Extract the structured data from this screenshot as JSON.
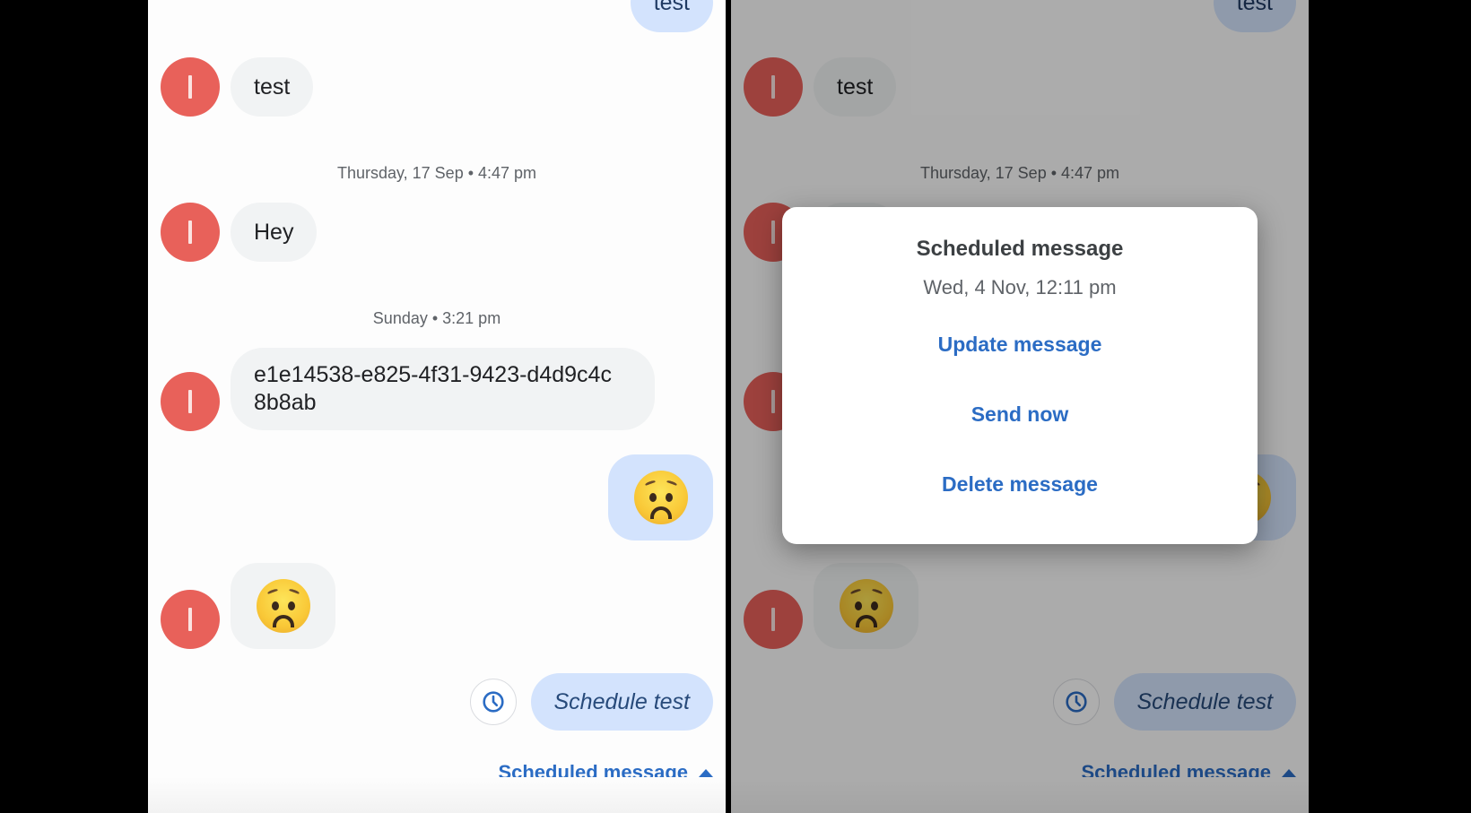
{
  "colors": {
    "accent": "#2b6cc4",
    "avatar": "#e8615a",
    "incoming_bubble": "#f1f3f4",
    "outgoing_bubble": "#d3e3fd",
    "scrim": "rgba(0,0,0,0.32)"
  },
  "conversation": {
    "contact_initial": "I",
    "messages": [
      {
        "direction": "outgoing",
        "text": "test"
      },
      {
        "direction": "incoming",
        "text": "test"
      },
      {
        "type": "timestamp",
        "text": "Thursday, 17 Sep • 4:47 pm"
      },
      {
        "direction": "incoming",
        "text": "Hey"
      },
      {
        "type": "timestamp",
        "text": "Sunday • 3:21 pm"
      },
      {
        "direction": "incoming",
        "text": "e1e14538-e825-4f31-9423-d4d9c4c8b8ab",
        "line1": "e1e14538-e825-4f31-9423-d4d9c4c",
        "line2": "8b8ab"
      },
      {
        "direction": "outgoing",
        "emoji": "worried-face"
      },
      {
        "direction": "incoming",
        "emoji": "worried-face"
      }
    ],
    "scheduled": {
      "icon": "clock-icon",
      "text": "Schedule test"
    },
    "scheduled_toggle": {
      "label": "Scheduled message",
      "icon": "caret-up-icon"
    }
  },
  "dialog": {
    "title": "Scheduled message",
    "subtitle": "Wed, 4 Nov, 12:11 pm",
    "actions": [
      {
        "label": "Update message"
      },
      {
        "label": "Send now"
      },
      {
        "label": "Delete message"
      }
    ]
  }
}
